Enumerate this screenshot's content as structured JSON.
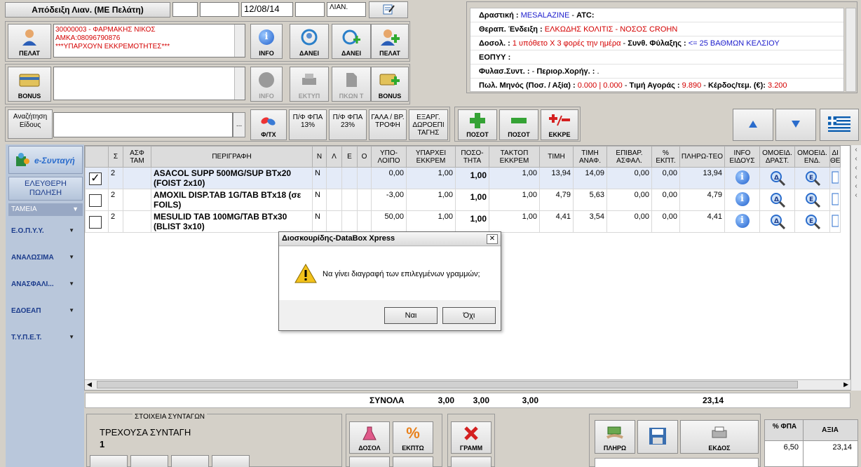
{
  "top": {
    "receipt_type": "Απόδειξη Λιαν. (ΜΕ Πελάτη)",
    "date": "12/08/14",
    "mode": "ΛΙΑΝ."
  },
  "customer": {
    "line1": "30000003 - ΦΑΡΜΑΚΗΣ ΝΙΚΟΣ",
    "line2": "ΑΜΚΑ:08096790876",
    "line3": "***ΥΠΑΡΧΟΥΝ ΕΚΚΡΕΜΟΤΗΤΕΣ***",
    "pelat_label": "ΠΕΛΑΤ",
    "buttons": [
      "INFO",
      "ΔΑΝΕΙ",
      "ΔΑΝΕΙ",
      "ΠΕΛΑΤ"
    ]
  },
  "bonus": {
    "label": "BONUS",
    "buttons": [
      "INFO",
      "ΕΚΤΥΠ",
      "ΠΚΩΝ Τ",
      "BONUS"
    ]
  },
  "search": {
    "label": "Αναζήτηση Είδους",
    "dots": "...",
    "buttons": [
      "Φ/ΤΧ",
      "Π/Φ ΦΠΑ 13%",
      "Π/Φ ΦΠΑ 23%",
      "ΓΑΛΑ / ΒΡ. ΤΡΟΦΗ",
      "ΕΞΑΡΓ. ΔΩΡΟΕΠΙ ΤΑΓΗΣ"
    ],
    "action_buttons": [
      "ΠΟΣΟΤ",
      "ΠΟΣΟΤ",
      "ΕΚΚΡΕ"
    ]
  },
  "info": {
    "drastiki_label": "Δραστική :",
    "drastiki": "MESALAZINE",
    "atc_label": "ATC:",
    "endeixi_label": "Θεραπ. Ένδειξη :",
    "endeixi": "ΕΛΚΩΔΗΣ ΚΟΛΙΤΙΣ - ΝΟΣΟΣ CROHN",
    "dosol_label": "Δοσολ. :",
    "dosol": "1 υπόθετο Χ 3 φορές την ημέρα",
    "fylaxi_label": "Συνθ. Φύλαξης :",
    "fylaxi": "<= 25 ΒΑΘΜΩΝ ΚΕΛΣΙΟΥ",
    "eopyy_label": "ΕΟΠΥΥ :",
    "fylas_label": "Φυλασ.Συντ. :",
    "perior_label": "Περιορ.Χορήγ. :",
    "pol_label": "Πωλ. Μηνός (Ποσ. / Αξία) :",
    "pol_value": "0.000 | 0.000",
    "timi_agoras_label": "Τιμή Αγοράς :",
    "timi_agoras": "9.890",
    "kerdos_label": "Κέρδος/τεμ. (€):",
    "kerdos": "3.200"
  },
  "sidebar": {
    "esyntagi": "e-Συνταγή",
    "eleftheri": "ΕΛΕΥΘΕΡΗ ΠΩΛΗΣΗ",
    "tameia": "ΤΑΜΕΙΑ",
    "items": [
      "Ε.Ο.Π.Υ.Υ.",
      "ΑΝΑΛΩΣΙΜΑ",
      "ΑΝΑΣΦΑΛΙ...",
      "ΕΔΟΕΑΠ",
      "Τ.Υ.Π.Ε.Τ."
    ]
  },
  "table": {
    "headers": [
      "",
      "Σ",
      "ΑΣΦ ΤΑΜ",
      "ΠΕΡΙΓΡΑΦΗ",
      "Ν",
      "Λ",
      "Ε",
      "Ο",
      "ΥΠΟ-ΛΟΙΠΟ",
      "ΥΠΑΡΧΕΙ ΕΚΚΡΕΜ",
      "ΠΟΣΟ-ΤΗΤΑ",
      "ΤΑΚΤΟΠ ΕΚΚΡΕΜ",
      "ΤΙΜΗ",
      "ΤΙΜΗ ΑΝΑΦ.",
      "ΕΠΙΒΑΡ. ΑΣΦΑΛ.",
      "% ΕΚΠΤ.",
      "ΠΛΗΡΩ-ΤΕΟ",
      "INFO ΕΙΔΟΥΣ",
      "ΟΜΟΕΙΔ. ΔΡΑΣΤ.",
      "ΟΜΟΕΙΔ. ΕΝΔ.",
      "ΔΙ ΘΕ"
    ],
    "rows": [
      {
        "checked": "✓",
        "s": "2",
        "desc": "ASACOL SUPP 500MG/SUP BTx20 (FOIST 2x10)",
        "n": "N",
        "ypoloipo": "0,00",
        "yparxei": "1,00",
        "posotita": "1,00",
        "taktop": "1,00",
        "timi": "13,94",
        "timi_anaf": "14,09",
        "epivar": "0,00",
        "ekpt": "0,00",
        "plirwteo": "13,94"
      },
      {
        "checked": "",
        "s": "2",
        "desc": "AMOXIL DISP.TAB 1G/TAB BTx18 (σε FOILS)",
        "n": "N",
        "ypoloipo": "-3,00",
        "yparxei": "1,00",
        "posotita": "1,00",
        "taktop": "1,00",
        "timi": "4,79",
        "timi_anaf": "5,63",
        "epivar": "0,00",
        "ekpt": "0,00",
        "plirwteo": "4,79"
      },
      {
        "checked": "",
        "s": "2",
        "desc": "MESULID TAB 100MG/TAB BTx30 (BLIST 3x10)",
        "n": "N",
        "ypoloipo": "50,00",
        "yparxei": "1,00",
        "posotita": "1,00",
        "taktop": "1,00",
        "timi": "4,41",
        "timi_anaf": "3,54",
        "epivar": "0,00",
        "ekpt": "0,00",
        "plirwteo": "4,41"
      }
    ]
  },
  "totals": {
    "label": "ΣΥΝΟΛΑ",
    "yparxei": "3,00",
    "posotita": "3,00",
    "taktop": "3,00",
    "plirwteo": "23,14"
  },
  "dialog": {
    "title": "Διοσκουρίδης-DataBox Xpress",
    "message": "Να γίνει διαγραφή των επιλεγμένων γραμμών;",
    "yes": "Ναι",
    "no": "Όχι",
    "close": "✕"
  },
  "bottom": {
    "syntagon_title": "ΣΤΟΙΧΕΙΑ ΣΥΝΤΑΓΩΝ",
    "trexousa": "ΤΡΕΧΟΥΣΑ ΣΥΝΤΑΓΗ",
    "trexousa_num": "1",
    "buttons": [
      "ΔΟΣΟΛ",
      "ΕΚΠΤΩ",
      "ΓΡΑΜΜ",
      "ΠΛΗΡΩ",
      "ΕΚΔΟΣ"
    ],
    "fpa_header": "% ΦΠΑ",
    "axia_header": "ΑΞΙΑ",
    "fpa_value": "6,50",
    "axia_value": "23,14"
  },
  "colors": {
    "panel_bg": "#d4d0c8",
    "sidebar_bg": "#b9c7db",
    "accent_blue": "#1f5fcc",
    "alert_red": "#d40000"
  }
}
